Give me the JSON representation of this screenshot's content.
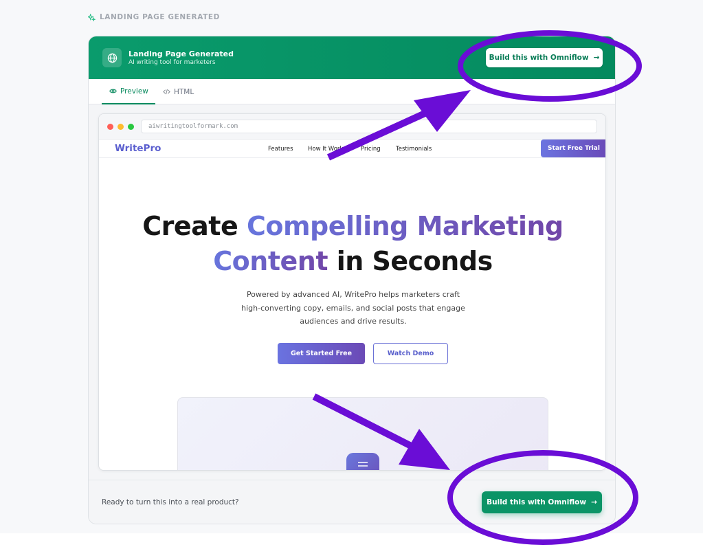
{
  "section_label": "LANDING PAGE GENERATED",
  "header": {
    "title": "Landing Page Generated",
    "subtitle": "AI writing tool for marketers",
    "button_label": "Build this with Omniflow",
    "button_arrow": "→"
  },
  "tabs": [
    {
      "label": "Preview",
      "icon": "eye-icon",
      "active": true
    },
    {
      "label": "HTML",
      "icon": "code-icon",
      "active": false
    }
  ],
  "browser": {
    "url": "aiwritingtoolformark.com",
    "dots": [
      "#ff5f57",
      "#febc2e",
      "#28c840"
    ]
  },
  "site": {
    "logo": "WritePro",
    "nav": [
      "Features",
      "How It Works",
      "Pricing",
      "Testimonials"
    ],
    "nav_cta": "Start Free Trial",
    "hero_line1_plain": "Create ",
    "hero_line1_accent": "Compelling Marketing",
    "hero_line2_accent": "Content",
    "hero_line2_plain": " in Seconds",
    "hero_paragraph": "Powered by advanced AI, WritePro helps marketers craft high-converting copy, emails, and social posts that engage audiences and drive results.",
    "primary_button": "Get Started Free",
    "secondary_button": "Watch Demo"
  },
  "footer": {
    "text": "Ready to turn this into a real product?",
    "button_label": "Build this with Omniflow",
    "button_arrow": "→"
  },
  "colors": {
    "brand_green": "#0a9b6c",
    "accent_purple": "#6b4ab6",
    "annotation_purple": "#6a0dd6"
  }
}
